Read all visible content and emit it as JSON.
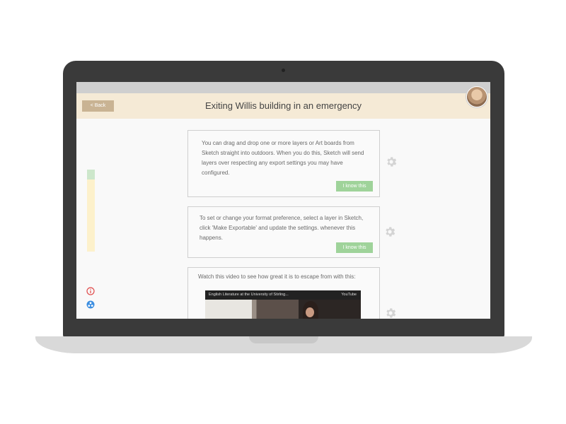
{
  "header": {
    "back_label": "< Back",
    "title": "Exiting Willis building in an emergency"
  },
  "progress": {
    "completed_fraction": 0.12
  },
  "cards": [
    {
      "text": "You can drag and drop one or more layers or Art boards from Sketch straight into outdoors. When you do this, Sketch will send layers over respecting any export settings you may have configured.",
      "button_label": "I know this"
    },
    {
      "text": "To set or change your format preference, select a layer in Sketch, click 'Make Exportable' and update the settings. whenever this happens.",
      "button_label": "I know this"
    },
    {
      "text": "Watch this video to see how great it is to escape from with this:",
      "video_title": "English Literature at the University of Stirling...",
      "video_source": "YouTube"
    }
  ],
  "icons": {
    "settings": "gear-icon",
    "info": "info-icon",
    "share": "share-icon",
    "info_color": "#e04b4b",
    "share_color": "#3d8ee0"
  },
  "colors": {
    "header_bg": "#f5ead6",
    "back_button": "#c9b393",
    "know_button": "#9fd39a",
    "progress_track": "#fdf1cb",
    "progress_fill": "#cde7cb"
  }
}
